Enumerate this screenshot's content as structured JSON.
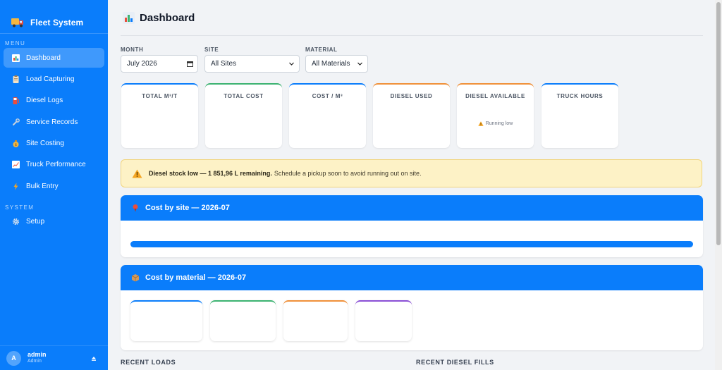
{
  "sidebar": {
    "brand": "Fleet System",
    "menu_label": "MENU",
    "menu": [
      {
        "label": "Dashboard",
        "icon": "chart-icon"
      },
      {
        "label": "Load Capturing",
        "icon": "clipboard-icon"
      },
      {
        "label": "Diesel Logs",
        "icon": "fuel-pump-icon"
      },
      {
        "label": "Service Records",
        "icon": "wrench-icon"
      },
      {
        "label": "Site Costing",
        "icon": "money-bag-icon"
      },
      {
        "label": "Truck Performance",
        "icon": "trend-chart-icon"
      },
      {
        "label": "Bulk Entry",
        "icon": "lightning-icon"
      }
    ],
    "system_label": "SYSTEM",
    "system": [
      {
        "label": "Setup",
        "icon": "gear-icon"
      }
    ],
    "user": {
      "initial": "A",
      "name": "admin",
      "role": "Admin"
    }
  },
  "header": {
    "title": "Dashboard"
  },
  "filters": {
    "month": {
      "label": "MONTH",
      "value": "July 2026"
    },
    "site": {
      "label": "SITE",
      "value": "All Sites"
    },
    "material": {
      "label": "MATERIAL",
      "value": "All Materials"
    }
  },
  "stats": [
    {
      "label": "TOTAL M³/T"
    },
    {
      "label": "TOTAL COST"
    },
    {
      "label": "COST / M³"
    },
    {
      "label": "DIESEL USED"
    },
    {
      "label": "DIESEL AVAILABLE",
      "note": "Running low"
    },
    {
      "label": "TRUCK HOURS"
    }
  ],
  "alert": {
    "bold": "Diesel stock low — 1 851,96 L remaining.",
    "text": "Schedule a pickup soon to avoid running out on site."
  },
  "panels": {
    "cost_by_site": "Cost by site — 2026-07",
    "cost_by_material": "Cost by material — 2026-07"
  },
  "bottom": {
    "recent_loads": "RECENT LOADS",
    "recent_diesel": "RECENT DIESEL FILLS"
  },
  "colors": {
    "primary": "#0a7dfb",
    "green": "#3cb371",
    "orange": "#f0913a",
    "purple": "#8a4fd6",
    "warning_bg": "#fdf2c6"
  }
}
